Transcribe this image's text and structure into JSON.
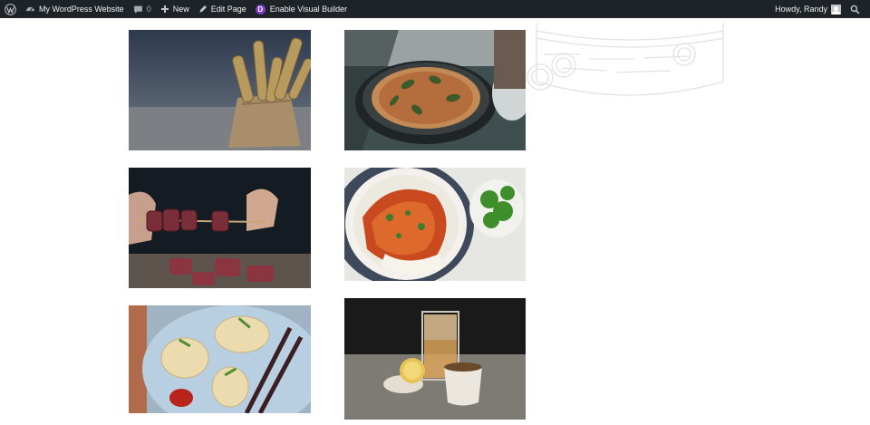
{
  "admin_bar": {
    "site_name": "My WordPress Website",
    "comments_count": "0",
    "new_label": "New",
    "edit_page_label": "Edit Page",
    "visual_builder_label": "Enable Visual Builder",
    "divi_letter": "D",
    "howdy_label": "Howdy, Randy",
    "icons": [
      "wordpress-logo-icon",
      "dashboard-icon",
      "comment-icon",
      "plus-icon",
      "pencil-icon",
      "divi-icon",
      "search-icon"
    ]
  },
  "gallery": {
    "images": [
      {
        "subject": "breadsticks"
      },
      {
        "subject": "pizza"
      },
      {
        "subject": "skewers"
      },
      {
        "subject": "curry-rice"
      },
      {
        "subject": "dumplings"
      },
      {
        "subject": "tea"
      }
    ]
  },
  "colors": {
    "admin_bar_bg": "#1d2327",
    "admin_bar_text": "#f0f0f1",
    "divi_purple": "#7e3bd0",
    "page_bg": "#ffffff"
  }
}
